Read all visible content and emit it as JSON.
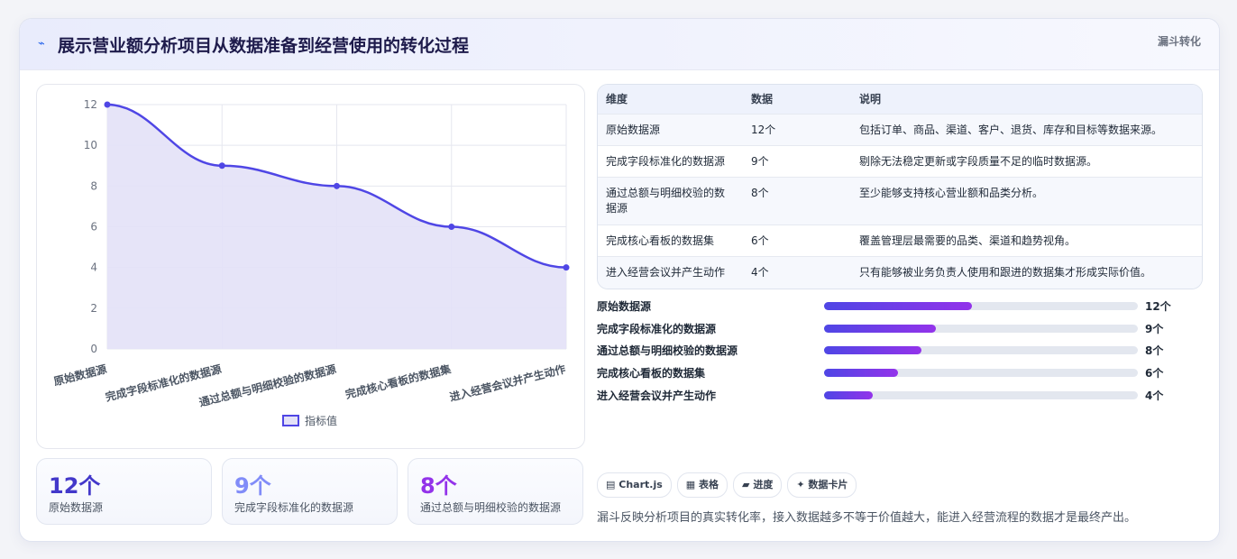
{
  "header": {
    "icon": "trend-icon",
    "title": "展示营业额分析项目从数据准备到经营使用的转化过程",
    "tag": "漏斗转化"
  },
  "chart_data": {
    "type": "area",
    "categories": [
      "原始数据源",
      "完成字段标准化的数据源",
      "通过总额与明细校验的数据源",
      "完成核心看板的数据集",
      "进入经营会议并产生动作"
    ],
    "series": [
      {
        "name": "指标值",
        "values": [
          12,
          9,
          8,
          6,
          4
        ]
      }
    ],
    "ylim": [
      0,
      12
    ],
    "yticks": [
      0,
      2,
      4,
      6,
      8,
      10,
      12
    ],
    "grid": true,
    "legend": "bottom",
    "colors": {
      "line": "#4f46e5",
      "fill": "#e3e1f7"
    }
  },
  "kpis": [
    {
      "value": "12个",
      "label": "原始数据源",
      "color": "#4338ca"
    },
    {
      "value": "9个",
      "label": "完成字段标准化的数据源",
      "color": "#818cf8"
    },
    {
      "value": "8个",
      "label": "通过总额与明细校验的数据源",
      "color": "#9333ea"
    }
  ],
  "table": {
    "headers": [
      "维度",
      "数据",
      "说明"
    ],
    "rows": [
      [
        "原始数据源",
        "12个",
        "包括订单、商品、渠道、客户、退货、库存和目标等数据来源。"
      ],
      [
        "完成字段标准化的数据源",
        "9个",
        "剔除无法稳定更新或字段质量不足的临时数据源。"
      ],
      [
        "通过总额与明细校验的数据源",
        "8个",
        "至少能够支持核心营业额和品类分析。"
      ],
      [
        "完成核心看板的数据集",
        "6个",
        "覆盖管理层最需要的品类、渠道和趋势视角。"
      ],
      [
        "进入经营会议并产生动作",
        "4个",
        "只有能够被业务负责人使用和跟进的数据集才形成实际价值。"
      ]
    ]
  },
  "progress": [
    {
      "label": "原始数据源",
      "value": 12,
      "max": 12,
      "display": "12个",
      "fraction": 0.47
    },
    {
      "label": "完成字段标准化的数据源",
      "value": 9,
      "max": 12,
      "display": "9个",
      "fraction": 0.355
    },
    {
      "label": "通过总额与明细校验的数据源",
      "value": 8,
      "max": 12,
      "display": "8个",
      "fraction": 0.31
    },
    {
      "label": "完成核心看板的数据集",
      "value": 6,
      "max": 12,
      "display": "6个",
      "fraction": 0.235
    },
    {
      "label": "进入经营会议并产生动作",
      "value": 4,
      "max": 12,
      "display": "4个",
      "fraction": 0.155
    }
  ],
  "chips": [
    {
      "icon": "chart-icon",
      "glyph": "▤",
      "label": "Chart.js"
    },
    {
      "icon": "table-icon",
      "glyph": "▦",
      "label": "表格"
    },
    {
      "icon": "progress-icon",
      "glyph": "▰",
      "label": "进度"
    },
    {
      "icon": "sparkle-icon",
      "glyph": "✦",
      "label": "数据卡片"
    }
  ],
  "note": "漏斗反映分析项目的真实转化率，接入数据越多不等于价值越大，能进入经营流程的数据才是最终产出。"
}
